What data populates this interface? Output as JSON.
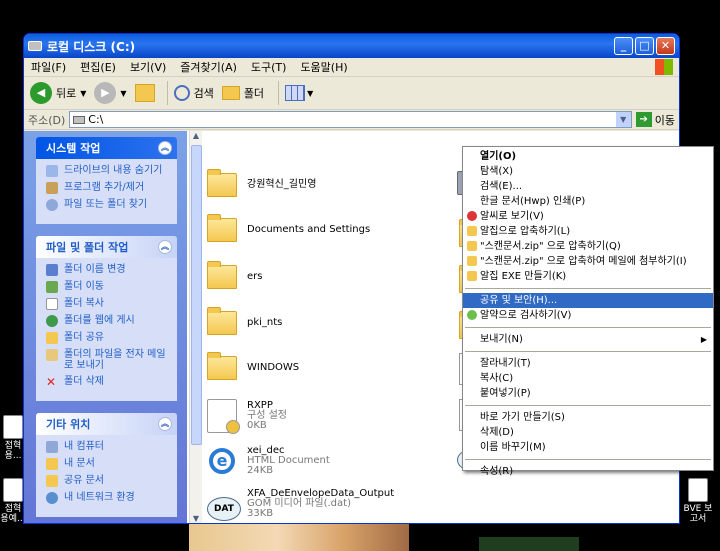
{
  "window": {
    "title": "로컬 디스크 (C:)",
    "controls": {
      "minimize": "_",
      "maximize": "□",
      "close": "✕"
    }
  },
  "menu": [
    "파일(F)",
    "편집(E)",
    "보기(V)",
    "즐겨찾기(A)",
    "도구(T)",
    "도움말(H)"
  ],
  "toolbar": {
    "back": "뒤로",
    "search": "검색",
    "folders": "폴더"
  },
  "address": {
    "label": "주소(D)",
    "value": "C:\\",
    "go": "이동"
  },
  "taskpane": {
    "system": {
      "title": "시스템 작업",
      "items": [
        "드라이브의 내용 숨기기",
        "프로그램 추가/제거",
        "파일 또는 폴더 찾기"
      ]
    },
    "file": {
      "title": "파일 및 폴더 작업",
      "items": [
        "폴더 이름 변경",
        "폴더 이동",
        "폴더 복사",
        "폴더를 웹에 게시",
        "폴더 공유",
        "폴더의 파일을 전자 메일로 보내기",
        "폴더 삭제"
      ]
    },
    "other": {
      "title": "기타 위치",
      "items": [
        "내 컴퓨터",
        "내 문서",
        "공유 문서",
        "내 네트워크 환경"
      ]
    }
  },
  "files": [
    {
      "name": "강원혁신_길민영"
    },
    {
      "name": "Documents and Settings"
    },
    {
      "name": "ers"
    },
    {
      "name": "pki_nts"
    },
    {
      "name": "WINDOWS"
    },
    {
      "name": "RXPP",
      "type": "구성 설정",
      "size": "0KB"
    },
    {
      "name": "xei_dec",
      "type": "HTML Document",
      "size": "24KB"
    },
    {
      "name": "XFA_DeEnvelopeData_Output",
      "type": "GOM 미디어 파일(.dat)",
      "size": "33KB"
    }
  ],
  "context_menu": [
    "열기(O)",
    "탐색(X)",
    "검색(E)...",
    "한글 문서(Hwp) 인쇄(P)",
    "알씨로 보기(V)",
    "알집으로 압축하기(L)",
    "\"스캔문서.zip\" 으로 압축하기(Q)",
    "\"스캔문서.zip\" 으로 압축하여 메일에 첨부하기(I)",
    "알집 EXE 만들기(K)",
    "공유 및 보안(H)...",
    "알약으로 검사하기(V)",
    "보내기(N)",
    "잘라내기(T)",
    "복사(C)",
    "붙여넣기(P)",
    "바로 가기 만들기(S)",
    "삭제(D)",
    "이름 바꾸기(M)",
    "속성(R)"
  ],
  "desktop": {
    "left_icon_1": "접혁 용...",
    "left_icon_2": "접혁 용예...",
    "right_icon": "BVE 보고서"
  }
}
